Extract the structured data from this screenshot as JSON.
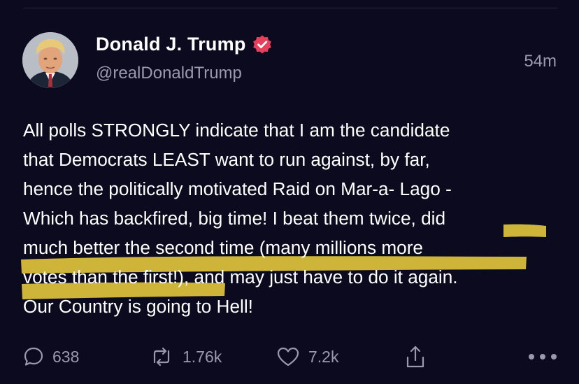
{
  "post": {
    "author": {
      "display_name": "Donald J. Trump",
      "handle": "@realDonaldTrump",
      "verified": true
    },
    "timestamp": "54m",
    "body_lines": [
      "All polls STRONGLY indicate that I am the candidate",
      "that Democrats LEAST want to run against, by far,",
      "hence the politically motivated Raid on Mar-a- Lago -",
      "Which has backfired, big time! I beat them twice, did",
      "much better the second time (many millions more",
      "votes than the first!), and may just have to do it again.",
      "Our Country is going to Hell!"
    ],
    "actions": {
      "replies": "638",
      "reposts": "1.76k",
      "likes": "7.2k"
    }
  },
  "colors": {
    "background": "#0b0a1e",
    "text": "#ffffff",
    "secondary_text": "#9a99ad",
    "verified_badge": "#e7405c",
    "highlight": "#d9bf3c"
  },
  "icons": {
    "verified": "verified-badge-icon",
    "reply": "speech-bubble-icon",
    "repost": "repost-arrows-icon",
    "like": "heart-icon",
    "share": "share-upload-icon",
    "more": "more-dots-icon"
  }
}
